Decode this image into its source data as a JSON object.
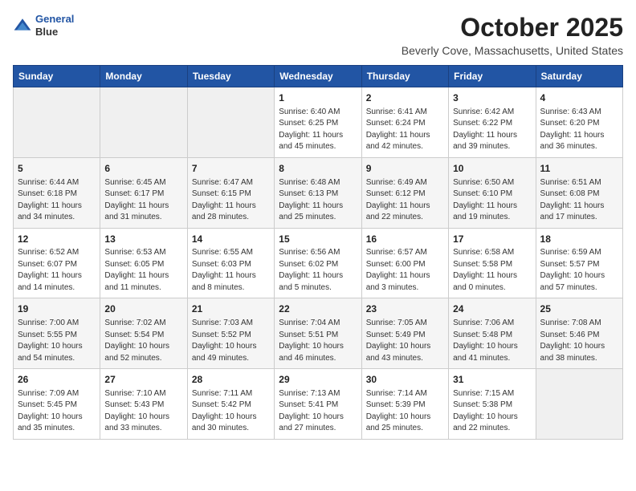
{
  "header": {
    "logo_line1": "General",
    "logo_line2": "Blue",
    "title": "October 2025",
    "subtitle": "Beverly Cove, Massachusetts, United States"
  },
  "days_of_week": [
    "Sunday",
    "Monday",
    "Tuesday",
    "Wednesday",
    "Thursday",
    "Friday",
    "Saturday"
  ],
  "weeks": [
    [
      {
        "day": "",
        "info": ""
      },
      {
        "day": "",
        "info": ""
      },
      {
        "day": "",
        "info": ""
      },
      {
        "day": "1",
        "info": "Sunrise: 6:40 AM\nSunset: 6:25 PM\nDaylight: 11 hours\nand 45 minutes."
      },
      {
        "day": "2",
        "info": "Sunrise: 6:41 AM\nSunset: 6:24 PM\nDaylight: 11 hours\nand 42 minutes."
      },
      {
        "day": "3",
        "info": "Sunrise: 6:42 AM\nSunset: 6:22 PM\nDaylight: 11 hours\nand 39 minutes."
      },
      {
        "day": "4",
        "info": "Sunrise: 6:43 AM\nSunset: 6:20 PM\nDaylight: 11 hours\nand 36 minutes."
      }
    ],
    [
      {
        "day": "5",
        "info": "Sunrise: 6:44 AM\nSunset: 6:18 PM\nDaylight: 11 hours\nand 34 minutes."
      },
      {
        "day": "6",
        "info": "Sunrise: 6:45 AM\nSunset: 6:17 PM\nDaylight: 11 hours\nand 31 minutes."
      },
      {
        "day": "7",
        "info": "Sunrise: 6:47 AM\nSunset: 6:15 PM\nDaylight: 11 hours\nand 28 minutes."
      },
      {
        "day": "8",
        "info": "Sunrise: 6:48 AM\nSunset: 6:13 PM\nDaylight: 11 hours\nand 25 minutes."
      },
      {
        "day": "9",
        "info": "Sunrise: 6:49 AM\nSunset: 6:12 PM\nDaylight: 11 hours\nand 22 minutes."
      },
      {
        "day": "10",
        "info": "Sunrise: 6:50 AM\nSunset: 6:10 PM\nDaylight: 11 hours\nand 19 minutes."
      },
      {
        "day": "11",
        "info": "Sunrise: 6:51 AM\nSunset: 6:08 PM\nDaylight: 11 hours\nand 17 minutes."
      }
    ],
    [
      {
        "day": "12",
        "info": "Sunrise: 6:52 AM\nSunset: 6:07 PM\nDaylight: 11 hours\nand 14 minutes."
      },
      {
        "day": "13",
        "info": "Sunrise: 6:53 AM\nSunset: 6:05 PM\nDaylight: 11 hours\nand 11 minutes."
      },
      {
        "day": "14",
        "info": "Sunrise: 6:55 AM\nSunset: 6:03 PM\nDaylight: 11 hours\nand 8 minutes."
      },
      {
        "day": "15",
        "info": "Sunrise: 6:56 AM\nSunset: 6:02 PM\nDaylight: 11 hours\nand 5 minutes."
      },
      {
        "day": "16",
        "info": "Sunrise: 6:57 AM\nSunset: 6:00 PM\nDaylight: 11 hours\nand 3 minutes."
      },
      {
        "day": "17",
        "info": "Sunrise: 6:58 AM\nSunset: 5:58 PM\nDaylight: 11 hours\nand 0 minutes."
      },
      {
        "day": "18",
        "info": "Sunrise: 6:59 AM\nSunset: 5:57 PM\nDaylight: 10 hours\nand 57 minutes."
      }
    ],
    [
      {
        "day": "19",
        "info": "Sunrise: 7:00 AM\nSunset: 5:55 PM\nDaylight: 10 hours\nand 54 minutes."
      },
      {
        "day": "20",
        "info": "Sunrise: 7:02 AM\nSunset: 5:54 PM\nDaylight: 10 hours\nand 52 minutes."
      },
      {
        "day": "21",
        "info": "Sunrise: 7:03 AM\nSunset: 5:52 PM\nDaylight: 10 hours\nand 49 minutes."
      },
      {
        "day": "22",
        "info": "Sunrise: 7:04 AM\nSunset: 5:51 PM\nDaylight: 10 hours\nand 46 minutes."
      },
      {
        "day": "23",
        "info": "Sunrise: 7:05 AM\nSunset: 5:49 PM\nDaylight: 10 hours\nand 43 minutes."
      },
      {
        "day": "24",
        "info": "Sunrise: 7:06 AM\nSunset: 5:48 PM\nDaylight: 10 hours\nand 41 minutes."
      },
      {
        "day": "25",
        "info": "Sunrise: 7:08 AM\nSunset: 5:46 PM\nDaylight: 10 hours\nand 38 minutes."
      }
    ],
    [
      {
        "day": "26",
        "info": "Sunrise: 7:09 AM\nSunset: 5:45 PM\nDaylight: 10 hours\nand 35 minutes."
      },
      {
        "day": "27",
        "info": "Sunrise: 7:10 AM\nSunset: 5:43 PM\nDaylight: 10 hours\nand 33 minutes."
      },
      {
        "day": "28",
        "info": "Sunrise: 7:11 AM\nSunset: 5:42 PM\nDaylight: 10 hours\nand 30 minutes."
      },
      {
        "day": "29",
        "info": "Sunrise: 7:13 AM\nSunset: 5:41 PM\nDaylight: 10 hours\nand 27 minutes."
      },
      {
        "day": "30",
        "info": "Sunrise: 7:14 AM\nSunset: 5:39 PM\nDaylight: 10 hours\nand 25 minutes."
      },
      {
        "day": "31",
        "info": "Sunrise: 7:15 AM\nSunset: 5:38 PM\nDaylight: 10 hours\nand 22 minutes."
      },
      {
        "day": "",
        "info": ""
      }
    ]
  ]
}
